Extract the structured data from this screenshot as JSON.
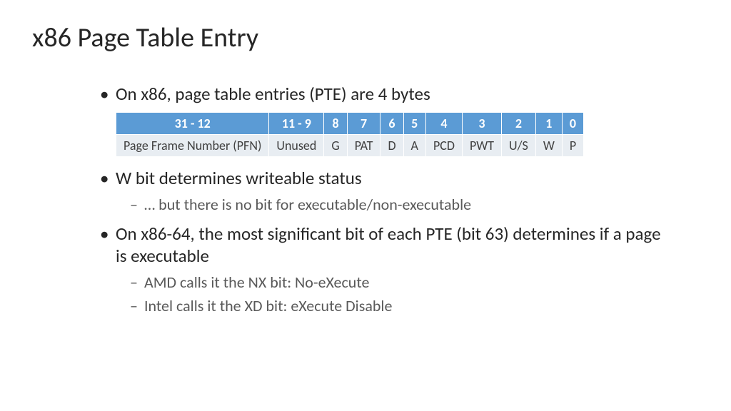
{
  "title": "x86 Page Table Entry",
  "bullets": {
    "b1": "On x86, page table entries (PTE) are 4 bytes",
    "b2": "W bit determines writeable status",
    "b2_sub1": "… but there is no bit for executable/non-executable",
    "b3": "On x86-64, the most significant bit of each PTE (bit 63) determines if a page is executable",
    "b3_sub1": "AMD calls it the NX bit: No-eXecute",
    "b3_sub2": "Intel calls it the XD bit: eXecute Disable"
  },
  "table": {
    "headers": [
      "31 - 12",
      "11 - 9",
      "8",
      "7",
      "6",
      "5",
      "4",
      "3",
      "2",
      "1",
      "0"
    ],
    "row": [
      "Page Frame Number (PFN)",
      "Unused",
      "G",
      "PAT",
      "D",
      "A",
      "PCD",
      "PWT",
      "U/S",
      "W",
      "P"
    ]
  }
}
